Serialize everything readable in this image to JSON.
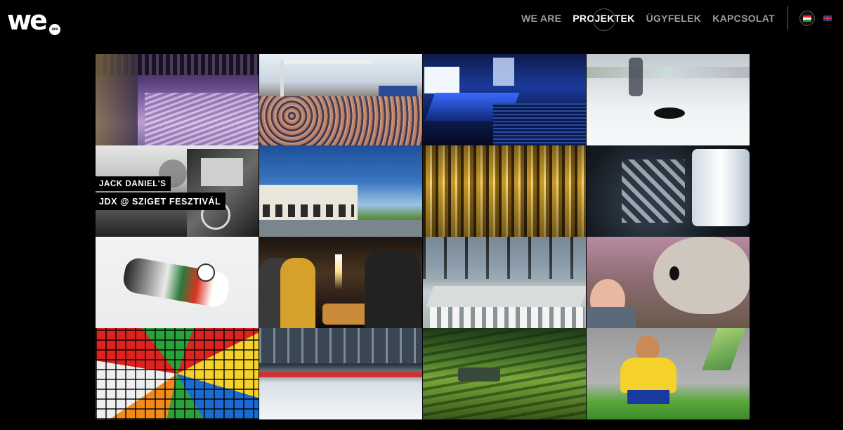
{
  "logo": {
    "text": "we",
    "badge": "are"
  },
  "nav": {
    "items": [
      {
        "label": "WE ARE",
        "active": false
      },
      {
        "label": "PROJEKTEK",
        "active": true
      },
      {
        "label": "ÜGYFELEK",
        "active": false
      },
      {
        "label": "KAPCSOLAT",
        "active": false
      }
    ],
    "languages": [
      {
        "code": "hu-flag-icon",
        "selected": true
      },
      {
        "code": "en-flag-icon",
        "selected": false
      }
    ]
  },
  "colors": {
    "background": "#000000",
    "nav_inactive": "#9c9c9c",
    "nav_active": "#ffffff"
  },
  "projects": [
    {
      "scene": "arena-seating"
    },
    {
      "scene": "pool-party-crowd"
    },
    {
      "scene": "conference-hall"
    },
    {
      "scene": "ice-hockey-puck"
    },
    {
      "scene": "truck-festival",
      "caption_top": "JACK DANIEL'S",
      "caption_bottom": "JDX @ SZIGET FESZTIVÁL"
    },
    {
      "scene": "warehouse-building"
    },
    {
      "scene": "golden-statuettes"
    },
    {
      "scene": "finlandia-shots"
    },
    {
      "scene": "hockey-player-on-ice"
    },
    {
      "scene": "party-celebration"
    },
    {
      "scene": "restaurant-terrace"
    },
    {
      "scene": "kids-mascot"
    },
    {
      "scene": "rubik-cubes"
    },
    {
      "scene": "ice-rink-arena"
    },
    {
      "scene": "vineyard-car"
    },
    {
      "scene": "boy-on-grass"
    }
  ]
}
